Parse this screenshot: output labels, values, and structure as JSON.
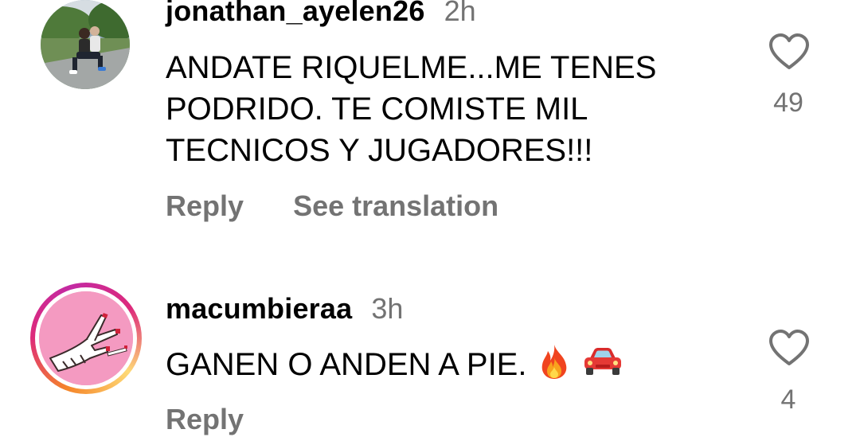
{
  "comments": [
    {
      "username": "jonathan_ayelen26",
      "time": "2h",
      "lines": [
        "ANDATE RIQUELME...ME TENES",
        "PODRIDO. TE COMISTE MIL",
        "TECNICOS Y JUGADORES!!!"
      ],
      "reply_label": "Reply",
      "translate_label": "See translation",
      "likes": "49",
      "avatar_icon": "user-photo-avatar",
      "like_icon": "heart-outline-icon"
    },
    {
      "username": "macumbieraa",
      "time": "3h",
      "text": "GANEN O ANDEN A PIE.",
      "emojis": [
        "fire-emoji",
        "car-emoji"
      ],
      "reply_label": "Reply",
      "likes": "4",
      "avatar_icon": "hand-illustration-avatar",
      "has_story_ring": true,
      "like_icon": "heart-outline-icon"
    }
  ],
  "colors": {
    "text": "#000000",
    "secondary": "#737373",
    "background": "#ffffff",
    "avatar_pink": "#f49ac1"
  }
}
